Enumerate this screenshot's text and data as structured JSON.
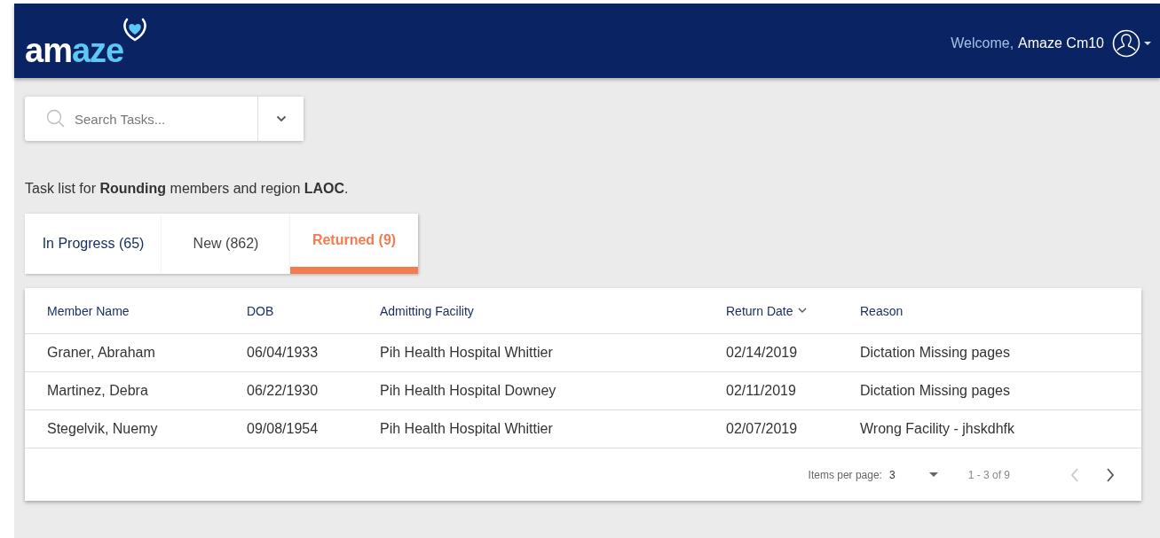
{
  "header": {
    "logo": [
      {
        "text": "am",
        "accent": false
      },
      {
        "text": "aze",
        "accent": true
      }
    ],
    "welcome": "Welcome,",
    "user_name": "Amaze Cm10"
  },
  "search": {
    "placeholder": "Search Tasks..."
  },
  "task_list_caption": "Task list for **Rounding** members and region **LAOC**.",
  "tabs": [
    {
      "label": "In Progress (65)",
      "selected": false
    },
    {
      "label": "New (862)",
      "selected": false
    },
    {
      "label": "Returned (9)",
      "selected": true
    }
  ],
  "table": {
    "columns": [
      {
        "label": "Member Name",
        "sorted": false
      },
      {
        "label": "DOB",
        "sorted": false
      },
      {
        "label": "Admitting Facility",
        "sorted": false
      },
      {
        "label": "Return Date",
        "sorted": true
      },
      {
        "label": "Reason",
        "sorted": false
      }
    ],
    "rows": [
      [
        "Graner, Abraham",
        "06/04/1933",
        "Pih Health Hospital Whittier",
        "02/14/2019",
        "Dictation Missing pages"
      ],
      [
        "Martinez, Debra",
        "06/22/1930",
        "Pih Health Hospital Downey",
        "02/11/2019",
        "Dictation Missing pages"
      ],
      [
        "Stegelvik, Nuemy",
        "09/08/1954",
        "Pih Health Hospital Whittier",
        "02/07/2019",
        "Wrong Facility - jhskdhfk"
      ]
    ]
  },
  "paginator": {
    "items_per_page_label": "Items per page:",
    "items_per_page": "3",
    "range": "1 - 3 of 9",
    "previous_disabled": true,
    "next_disabled": false
  }
}
